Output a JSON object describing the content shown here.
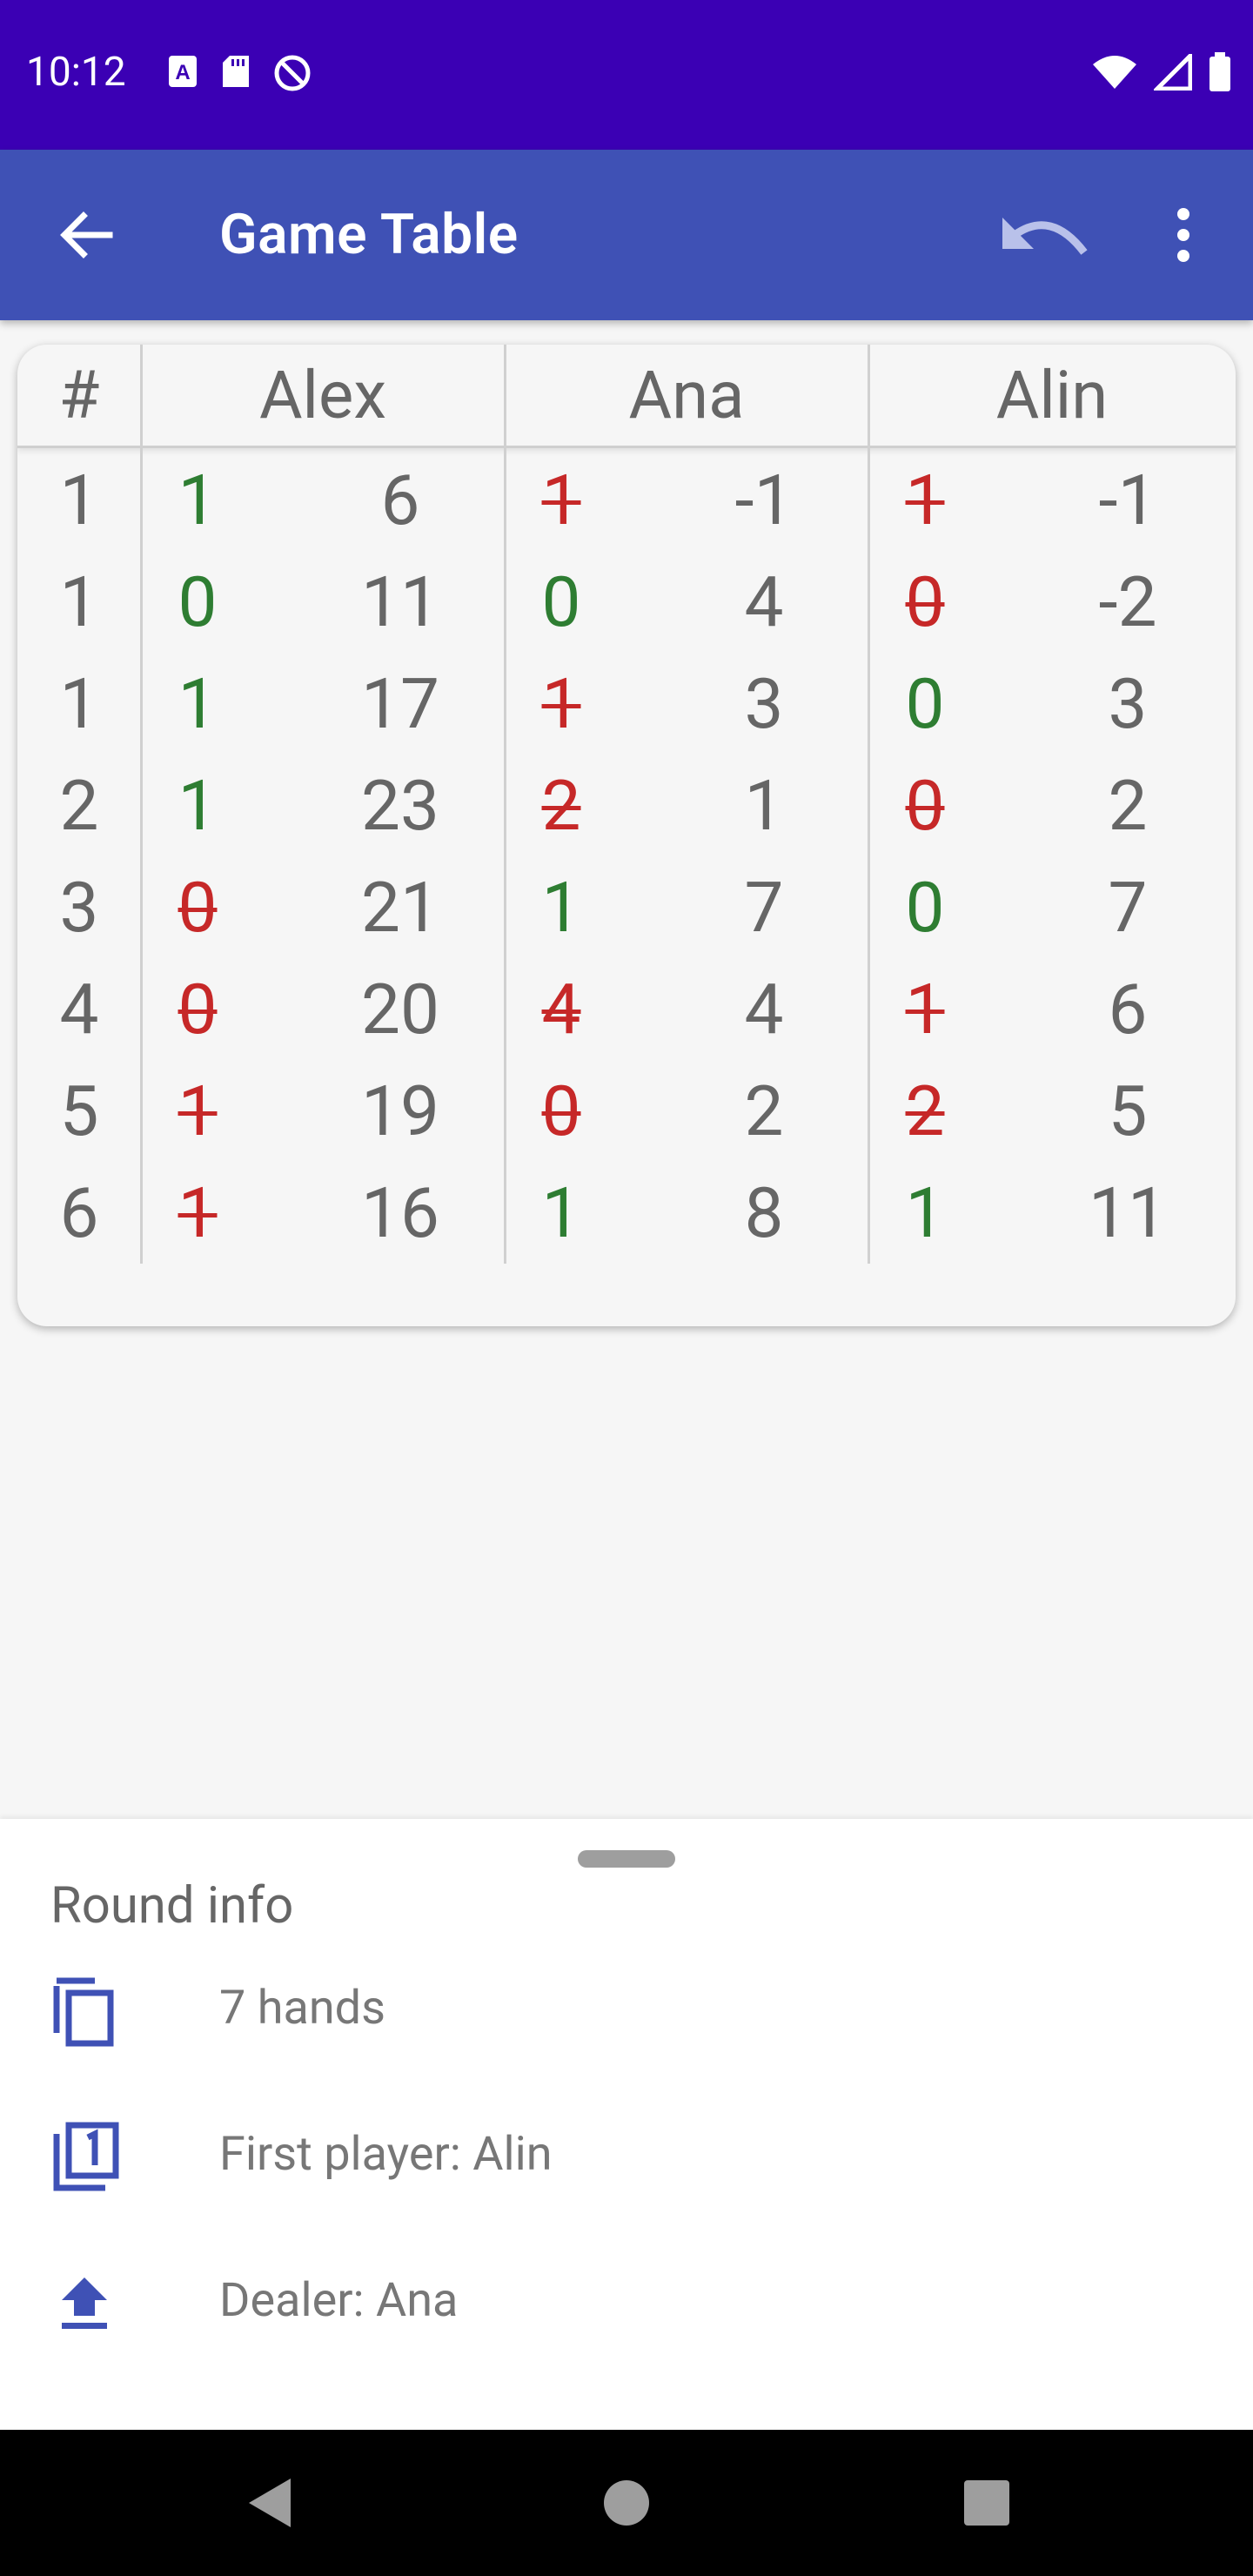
{
  "status_bar": {
    "time": "10:12",
    "icons_left": [
      "text-a-icon",
      "sd-card-icon",
      "do-not-disturb-icon"
    ],
    "icons_right": [
      "wifi-icon",
      "signal-icon",
      "battery-icon"
    ]
  },
  "app_bar": {
    "title": "Game Table",
    "back_icon": "arrow-back-icon",
    "undo_icon": "undo-icon",
    "more_icon": "more-vert-icon"
  },
  "table": {
    "headers": [
      "#",
      "Alex",
      "Ana",
      "Alin"
    ],
    "rows": [
      {
        "round": "1",
        "cells": [
          {
            "bid": "1",
            "made": true,
            "score": "6"
          },
          {
            "bid": "1",
            "made": false,
            "score": "-1"
          },
          {
            "bid": "1",
            "made": false,
            "score": "-1"
          }
        ]
      },
      {
        "round": "1",
        "cells": [
          {
            "bid": "0",
            "made": true,
            "score": "11"
          },
          {
            "bid": "0",
            "made": true,
            "score": "4"
          },
          {
            "bid": "0",
            "made": false,
            "score": "-2"
          }
        ]
      },
      {
        "round": "1",
        "cells": [
          {
            "bid": "1",
            "made": true,
            "score": "17"
          },
          {
            "bid": "1",
            "made": false,
            "score": "3"
          },
          {
            "bid": "0",
            "made": true,
            "score": "3"
          }
        ]
      },
      {
        "round": "2",
        "cells": [
          {
            "bid": "1",
            "made": true,
            "score": "23"
          },
          {
            "bid": "2",
            "made": false,
            "score": "1"
          },
          {
            "bid": "0",
            "made": false,
            "score": "2"
          }
        ]
      },
      {
        "round": "3",
        "cells": [
          {
            "bid": "0",
            "made": false,
            "score": "21"
          },
          {
            "bid": "1",
            "made": true,
            "score": "7"
          },
          {
            "bid": "0",
            "made": true,
            "score": "7"
          }
        ]
      },
      {
        "round": "4",
        "cells": [
          {
            "bid": "0",
            "made": false,
            "score": "20"
          },
          {
            "bid": "4",
            "made": false,
            "score": "4"
          },
          {
            "bid": "1",
            "made": false,
            "score": "6"
          }
        ]
      },
      {
        "round": "5",
        "cells": [
          {
            "bid": "1",
            "made": false,
            "score": "19"
          },
          {
            "bid": "0",
            "made": false,
            "score": "2"
          },
          {
            "bid": "2",
            "made": false,
            "score": "5"
          }
        ]
      },
      {
        "round": "6",
        "cells": [
          {
            "bid": "1",
            "made": false,
            "score": "16"
          },
          {
            "bid": "1",
            "made": true,
            "score": "8"
          },
          {
            "bid": "1",
            "made": true,
            "score": "11"
          }
        ]
      }
    ]
  },
  "round_info": {
    "title": "Round info",
    "items": [
      {
        "icon": "copy-cards-icon",
        "text": "7 hands"
      },
      {
        "icon": "filter-1-icon",
        "text": "First player: Alin"
      },
      {
        "icon": "upload-icon",
        "text": "Dealer: Ana"
      }
    ]
  },
  "colors": {
    "status_bar": "#3b00b4",
    "app_bar": "#3f51b5",
    "bid_made": "#2e7d32",
    "bid_failed": "#c62828",
    "icon_accent": "#3f51b5"
  },
  "nav": {
    "back_icon": "nav-back-icon",
    "home_icon": "nav-home-icon",
    "recents_icon": "nav-recents-icon"
  }
}
